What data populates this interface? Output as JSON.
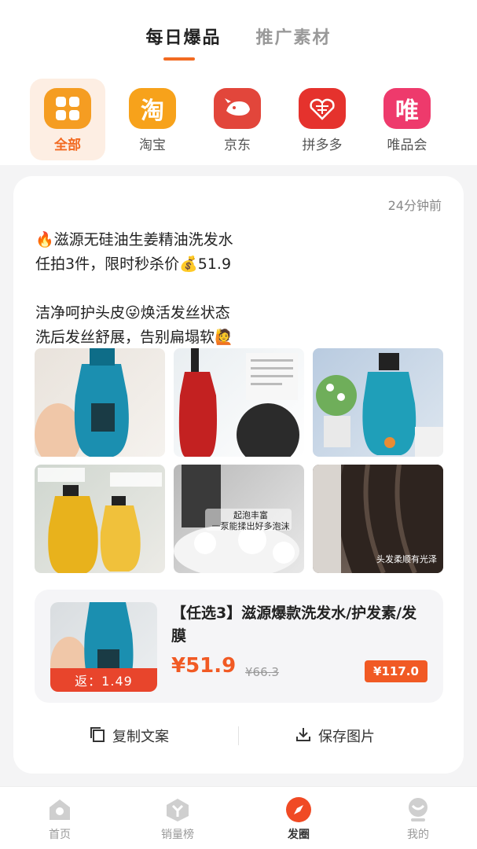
{
  "header": {
    "tabs": [
      {
        "label": "每日爆品",
        "active": true
      },
      {
        "label": "推广素材",
        "active": false
      }
    ],
    "accent": "#f26a21"
  },
  "platforms": [
    {
      "label": "全部",
      "icon": "grid-icon",
      "color": "#f59d22",
      "active": true
    },
    {
      "label": "淘宝",
      "icon": "taobao-icon",
      "glyph": "淘",
      "color": "#f7a21b",
      "active": false
    },
    {
      "label": "京东",
      "icon": "jd-dog-icon",
      "color": "#e2463b",
      "active": false
    },
    {
      "label": "拼多多",
      "icon": "pinduoduo-icon",
      "color": "#e5322d",
      "active": false
    },
    {
      "label": "唯品会",
      "icon": "vip-icon",
      "glyph": "唯",
      "color": "#ee3a6c",
      "active": false
    }
  ],
  "post": {
    "time": "24分钟前",
    "text": "🔥滋源无硅油生姜精油洗发水\n任拍3件，限时秒杀价💰51.9\n\n洁净呵护头皮😜焕活发丝状态\n洗后发丝舒展，告别扁塌软🙋",
    "images": [
      {
        "name": "photo-blue-bottle-hand"
      },
      {
        "name": "photo-red-bottle-scalp"
      },
      {
        "name": "photo-blue-bottle-flowers"
      },
      {
        "name": "photo-yellow-bottles"
      },
      {
        "name": "photo-washing-foam",
        "caption": "起泡丰富\n一泵能揉出好多泡沫"
      },
      {
        "name": "photo-hair-result",
        "caption": "头发柔顺有光泽"
      }
    ]
  },
  "product": {
    "title": "【任选3】滋源爆款洗发水/护发素/发膜",
    "rebate": "返：1.49",
    "price": "¥51.9",
    "old_price": "¥66.3",
    "badge": "¥117.0"
  },
  "actions": {
    "copy": "复制文案",
    "save": "保存图片"
  },
  "nav": [
    {
      "label": "首页",
      "icon": "home-icon",
      "active": false
    },
    {
      "label": "销量榜",
      "icon": "ranking-icon",
      "active": false
    },
    {
      "label": "发圈",
      "icon": "share-circle-icon",
      "active": true
    },
    {
      "label": "我的",
      "icon": "profile-icon",
      "active": false
    }
  ]
}
